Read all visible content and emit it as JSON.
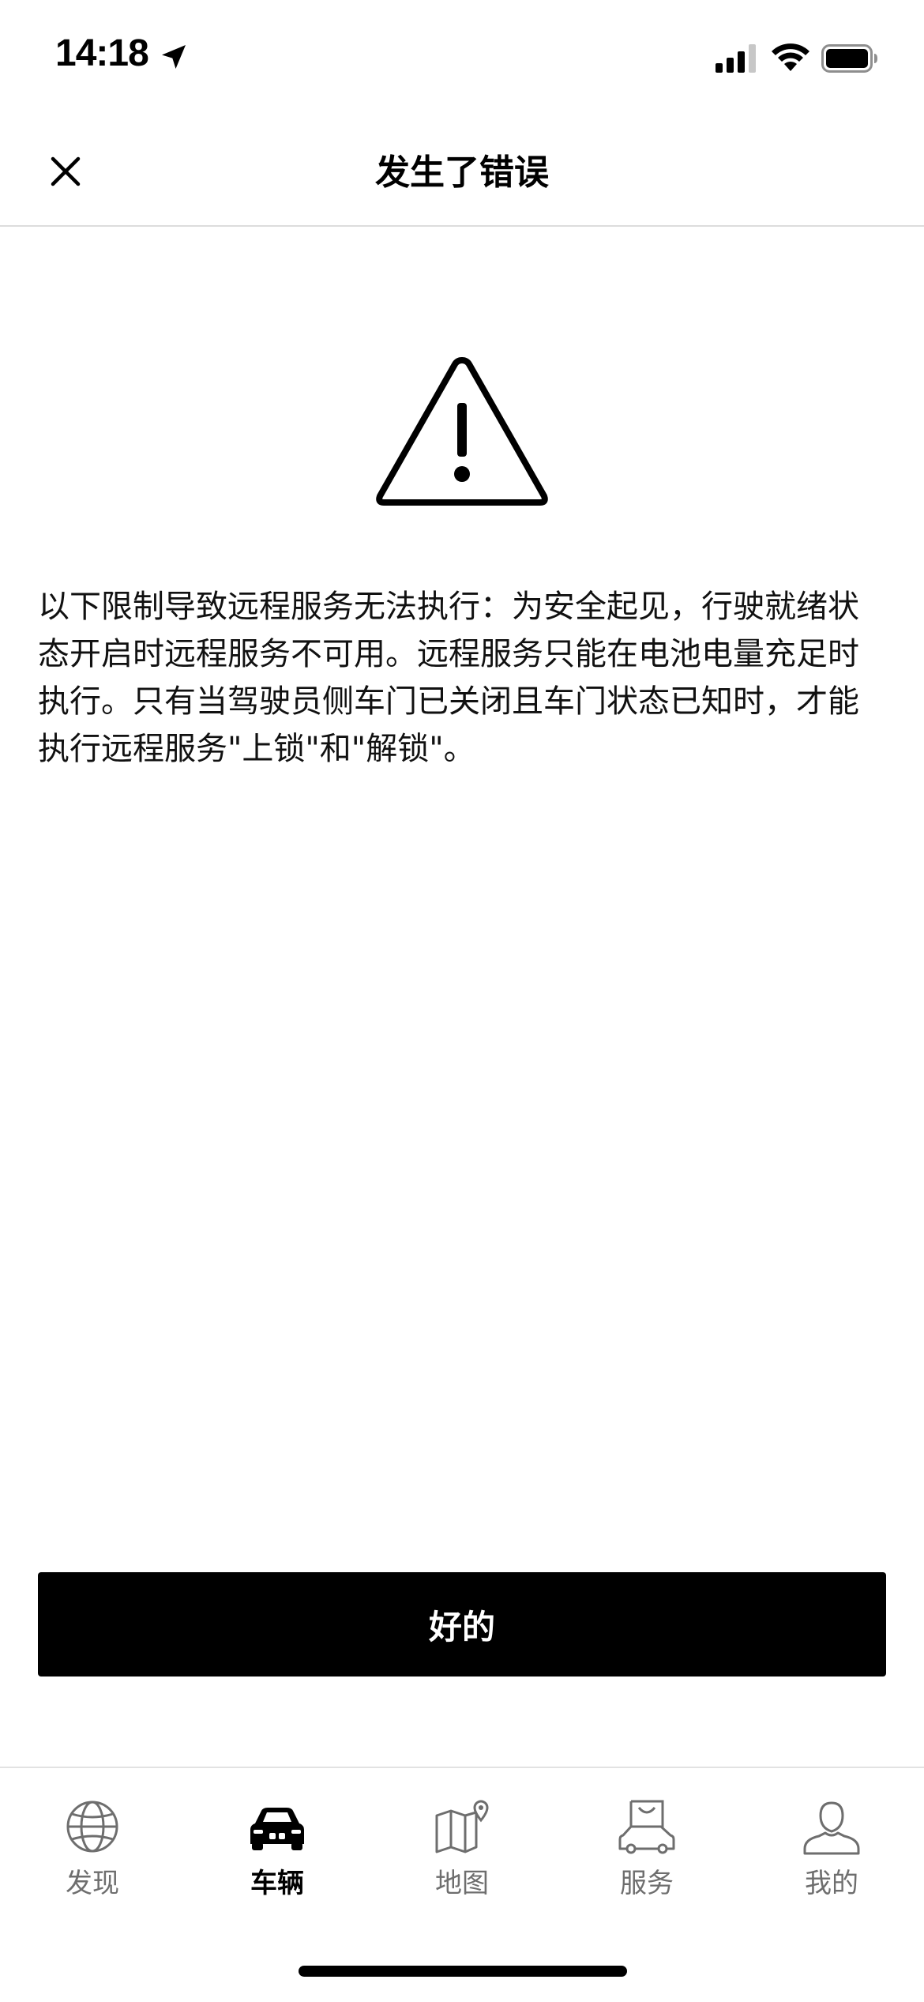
{
  "status_bar": {
    "time": "14:18"
  },
  "header": {
    "title": "发生了错误"
  },
  "message": {
    "text": "以下限制导致远程服务无法执行：为安全起见，行驶就绪状态开启时远程服务不可用。远程服务只能在电池电量充足时执行。只有当驾驶员侧车门已关闭且车门状态已知时，才能执行远程服务\"上锁\"和\"解锁\"。"
  },
  "actions": {
    "ok_label": "好的"
  },
  "tabs": [
    {
      "label": "发现",
      "icon": "globe-icon",
      "active": false
    },
    {
      "label": "车辆",
      "icon": "car-icon",
      "active": true
    },
    {
      "label": "地图",
      "icon": "map-icon",
      "active": false
    },
    {
      "label": "服务",
      "icon": "service-icon",
      "active": false
    },
    {
      "label": "我的",
      "icon": "profile-icon",
      "active": false
    }
  ],
  "colors": {
    "primary": "#000000",
    "background": "#ffffff",
    "inactive_tab": "#6e6e6e",
    "divider": "#dcdcdc"
  }
}
